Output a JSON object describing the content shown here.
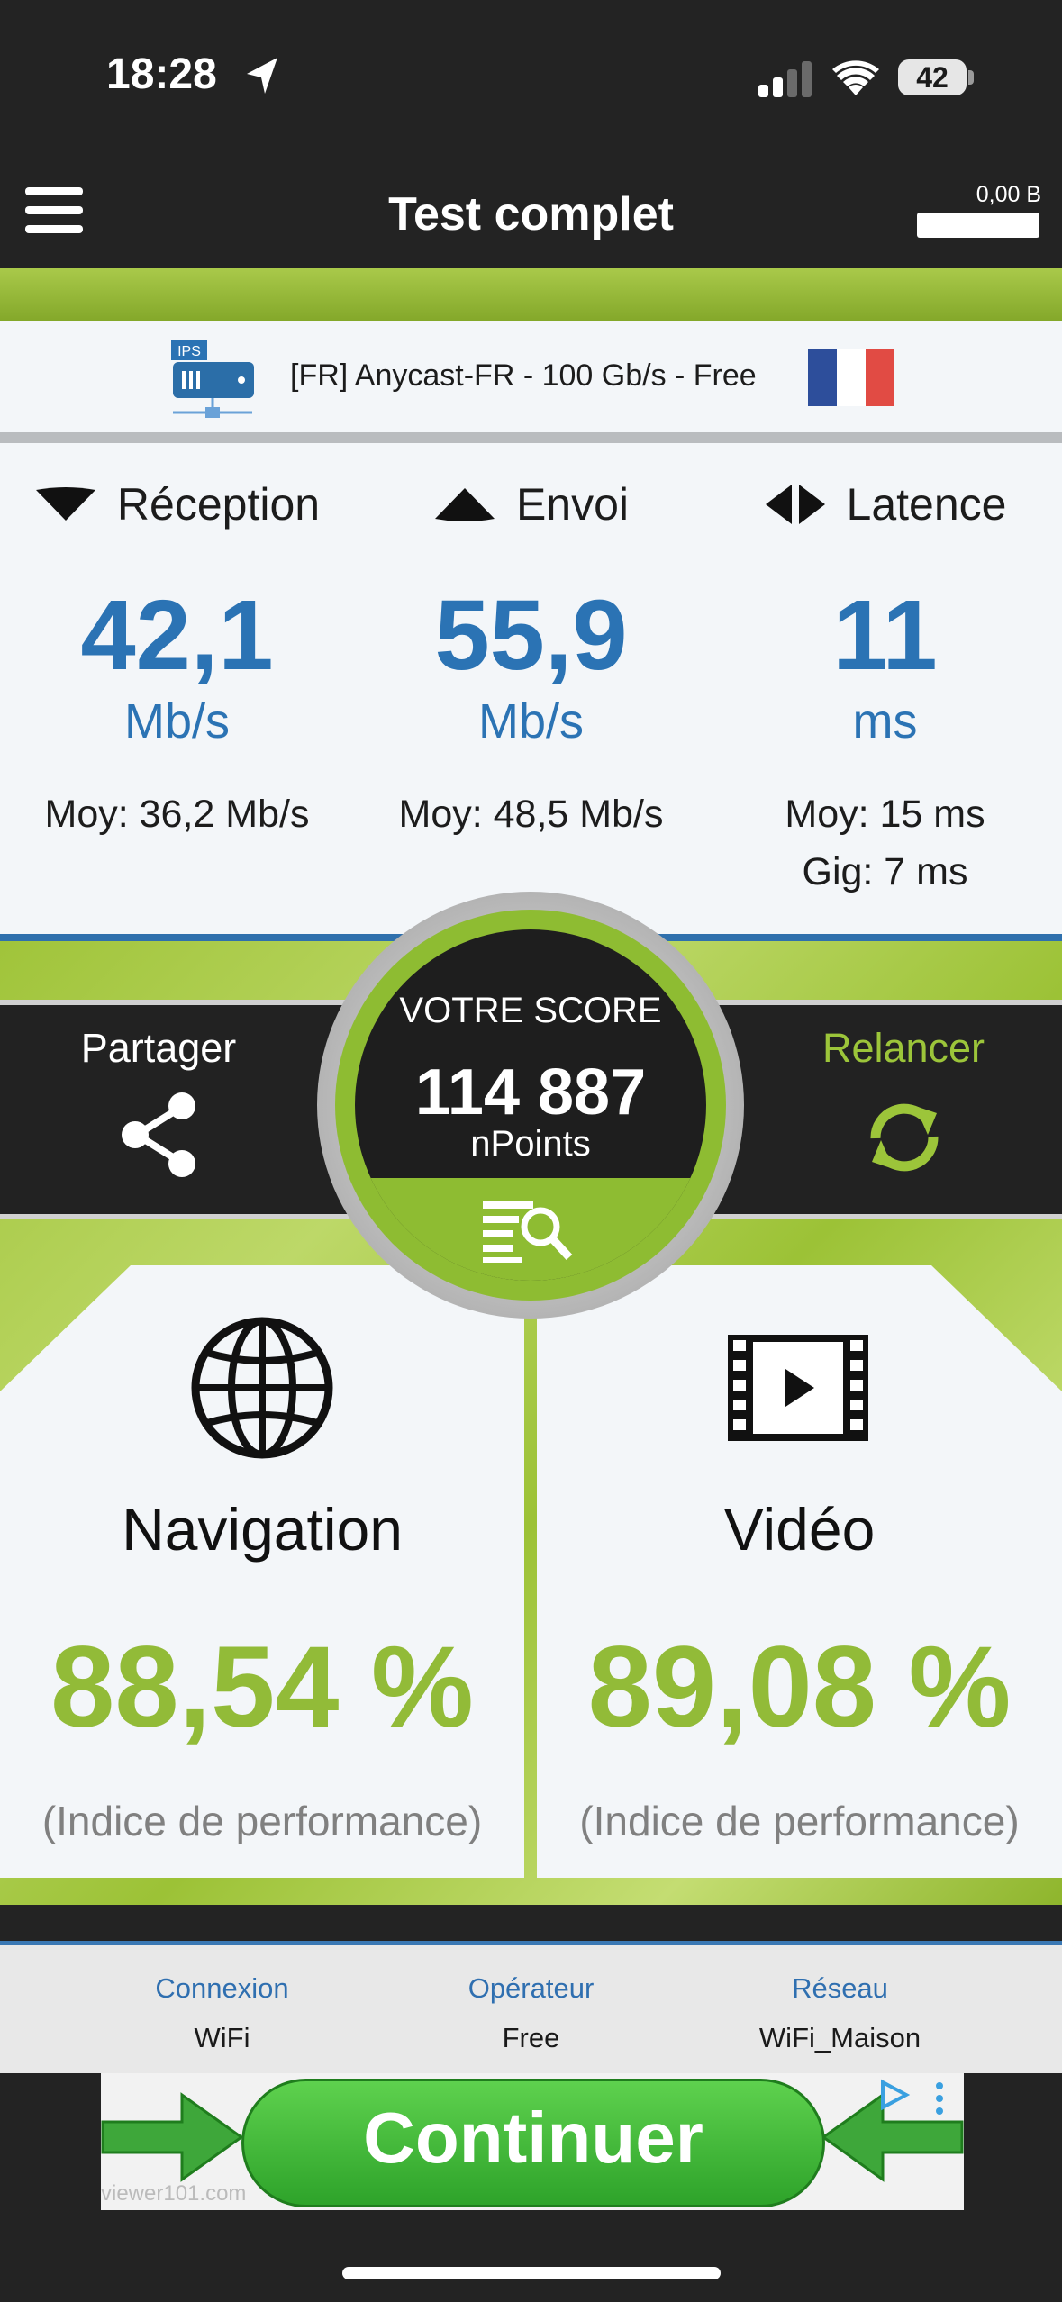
{
  "status_bar": {
    "time": "18:28",
    "battery": "42"
  },
  "header": {
    "title": "Test complet",
    "balance": "0,00 B"
  },
  "server": {
    "badge": "IPS",
    "name": "[FR] Anycast-FR - 100 Gb/s - Free"
  },
  "stats": [
    {
      "label": "Réception",
      "value": "42,1",
      "unit": "Mb/s",
      "avg": "Moy: 36,2 Mb/s",
      "extra": ""
    },
    {
      "label": "Envoi",
      "value": "55,9",
      "unit": "Mb/s",
      "avg": "Moy: 48,5 Mb/s",
      "extra": ""
    },
    {
      "label": "Latence",
      "value": "11",
      "unit": "ms",
      "avg": "Moy: 15 ms",
      "extra": "Gig: 7 ms"
    }
  ],
  "actions": {
    "share": "Partager",
    "relaunch": "Relancer"
  },
  "score": {
    "label": "VOTRE SCORE",
    "value": "114 887",
    "unit": "nPoints"
  },
  "performance": {
    "navigation": {
      "title": "Navigation",
      "value": "88,54 %",
      "sub": "(Indice de performance)"
    },
    "video": {
      "title": "Vidéo",
      "value": "89,08 %",
      "sub": "(Indice de performance)"
    }
  },
  "info": [
    {
      "label": "Connexion",
      "value": "WiFi"
    },
    {
      "label": "Opérateur",
      "value": "Free"
    },
    {
      "label": "Réseau",
      "value": "WiFi_Maison"
    }
  ],
  "ad": {
    "button": "Continuer",
    "watermark": "viewer101.com"
  },
  "colors": {
    "accent_green": "#92bb38",
    "stat_blue": "#2b73b4",
    "flag": [
      "#2d4e9b",
      "#ffffff",
      "#e14b44"
    ]
  }
}
